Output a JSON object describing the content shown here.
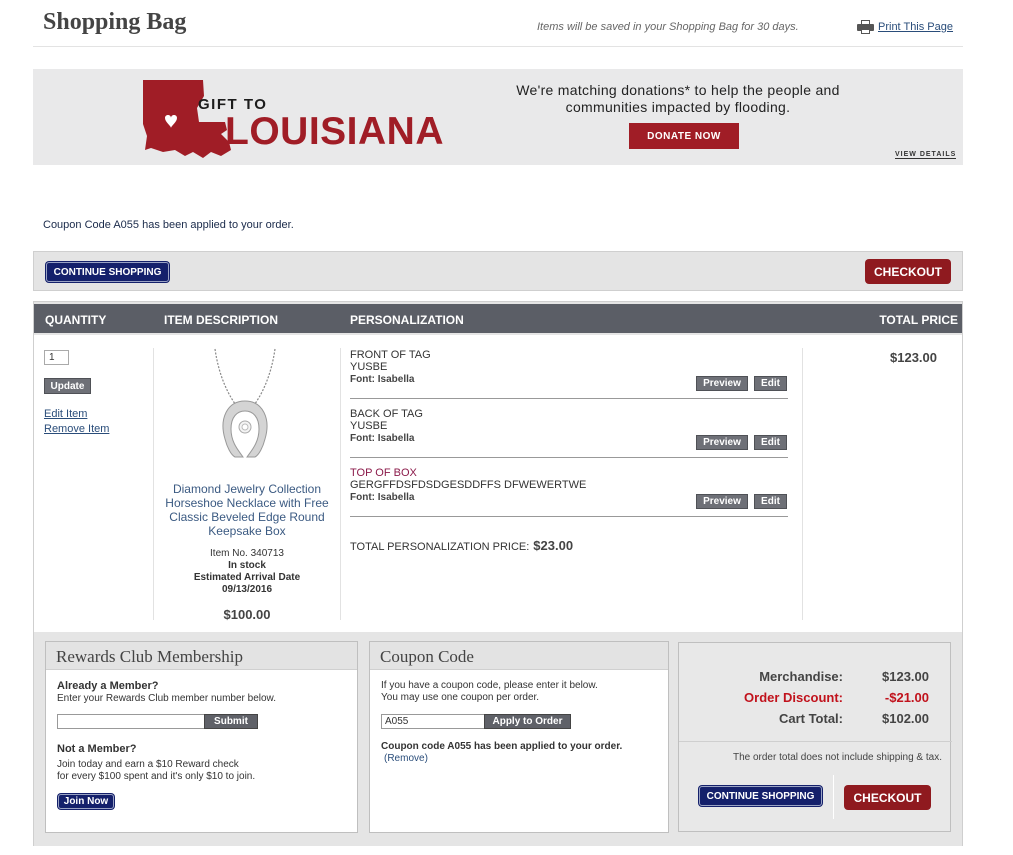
{
  "header": {
    "title": "Shopping Bag",
    "saved_note": "Items will be saved in your Shopping Bag for 30 days.",
    "print_label": "Print This Page",
    "print_icon": "printer-icon"
  },
  "banner": {
    "gift_to": "GIFT TO",
    "louisiana": "LOUISIANA",
    "message": "We're matching donations* to help the people and communities impacted by flooding.",
    "donate_label": "DONATE NOW",
    "view_details": "VIEW DETAILS",
    "brand_color": "#a01d26"
  },
  "coupon_message": "Coupon Code A055 has been applied to your order.",
  "actions": {
    "continue_label": "CONTINUE SHOPPING",
    "checkout_label": "CHECKOUT"
  },
  "table": {
    "headers": {
      "quantity": "QUANTITY",
      "description": "ITEM DESCRIPTION",
      "personalization": "PERSONALIZATION",
      "total": "TOTAL PRICE"
    }
  },
  "item": {
    "quantity": "1",
    "update_label": "Update",
    "edit_label": "Edit Item",
    "remove_label": "Remove Item",
    "name": "Diamond Jewelry Collection Horseshoe Necklace with Free Classic Beveled Edge Round Keepsake Box",
    "item_no": "Item No. 340713",
    "stock": "In stock",
    "arrival_label": "Estimated Arrival Date",
    "arrival_date": "09/13/2016",
    "price": "$100.00",
    "total_price": "$123.00"
  },
  "personalization": {
    "preview_label": "Preview",
    "edit_label": "Edit",
    "blocks": [
      {
        "title": "FRONT OF TAG",
        "value": "YUSBE",
        "font": "Font: Isabella"
      },
      {
        "title": "BACK OF TAG",
        "value": "YUSBE",
        "font": "Font: Isabella"
      },
      {
        "title": "TOP OF BOX",
        "value": "GERGFFDSFDSDGESDDFFS DFWEWERTWE",
        "font": "Font: Isabella"
      }
    ],
    "total_label": "TOTAL PERSONALIZATION PRICE:",
    "total_value": "$23.00"
  },
  "rewards": {
    "title": "Rewards Club Membership",
    "member_q": "Already a Member?",
    "member_text": "Enter your Rewards Club member number below.",
    "input_value": "",
    "submit_label": "Submit",
    "not_member_q": "Not a Member?",
    "not_member_line1": "Join today and earn a $10 Reward check",
    "not_member_line2": "for every $100 spent and it's only $10 to join.",
    "join_label": "Join Now"
  },
  "coupon": {
    "title": "Coupon Code",
    "line1": "If you have a coupon code, please enter it below.",
    "line2": "You may use one coupon per order.",
    "input_value": "A055",
    "apply_label": "Apply to Order",
    "applied_text": "Coupon code A055 has been applied to your order.",
    "remove_label": "(Remove)"
  },
  "summary": {
    "merch_label": "Merchandise:",
    "merch_value": "$123.00",
    "discount_label": "Order Discount:",
    "discount_value": "-$21.00",
    "total_label": "Cart Total:",
    "total_value": "$102.00",
    "note": "The order total does not include shipping & tax.",
    "continue_label": "CONTINUE SHOPPING",
    "checkout_label": "CHECKOUT",
    "discount_color": "#c1121c"
  }
}
